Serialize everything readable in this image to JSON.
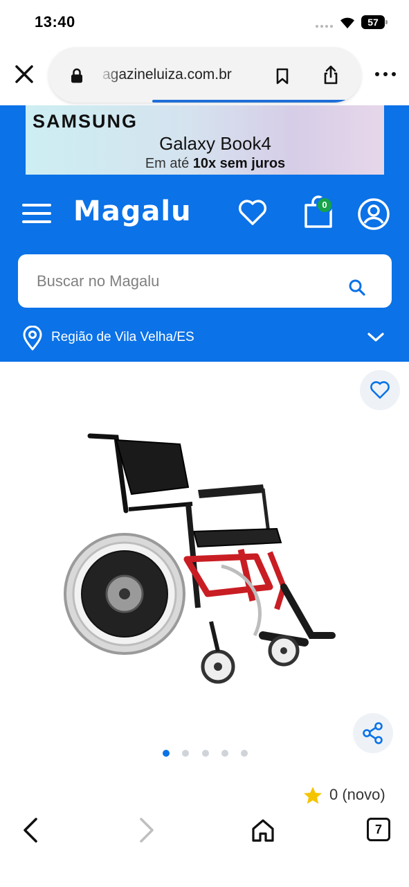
{
  "status_bar": {
    "time": "13:40",
    "battery": "57"
  },
  "browser": {
    "url": "agazineluiza.com.br"
  },
  "ad": {
    "brand": "SAMSUNG",
    "product": "Galaxy Book4",
    "tagline_prefix": "Em até ",
    "tagline_bold": "10x sem juros"
  },
  "header": {
    "logo": "Magalu",
    "cart_count": "0",
    "search_placeholder": "Buscar no Magalu",
    "location": "Região de Vila Velha/ES"
  },
  "product": {
    "image_count": 5,
    "active_image": 1,
    "rating": "0 (novo)"
  },
  "colors": {
    "brand_blue": "#0b72e7",
    "badge_green": "#17a34a",
    "star_yellow": "#f5c400"
  },
  "icons": [
    "close-icon",
    "lock-icon",
    "bookmark-icon",
    "share-icon",
    "more-icon",
    "menu-icon",
    "heart-icon",
    "cart-icon",
    "account-icon",
    "search-icon",
    "location-pin-icon",
    "chevron-down-icon",
    "star-icon",
    "back-icon",
    "forward-icon",
    "home-icon",
    "tabs-icon"
  ]
}
